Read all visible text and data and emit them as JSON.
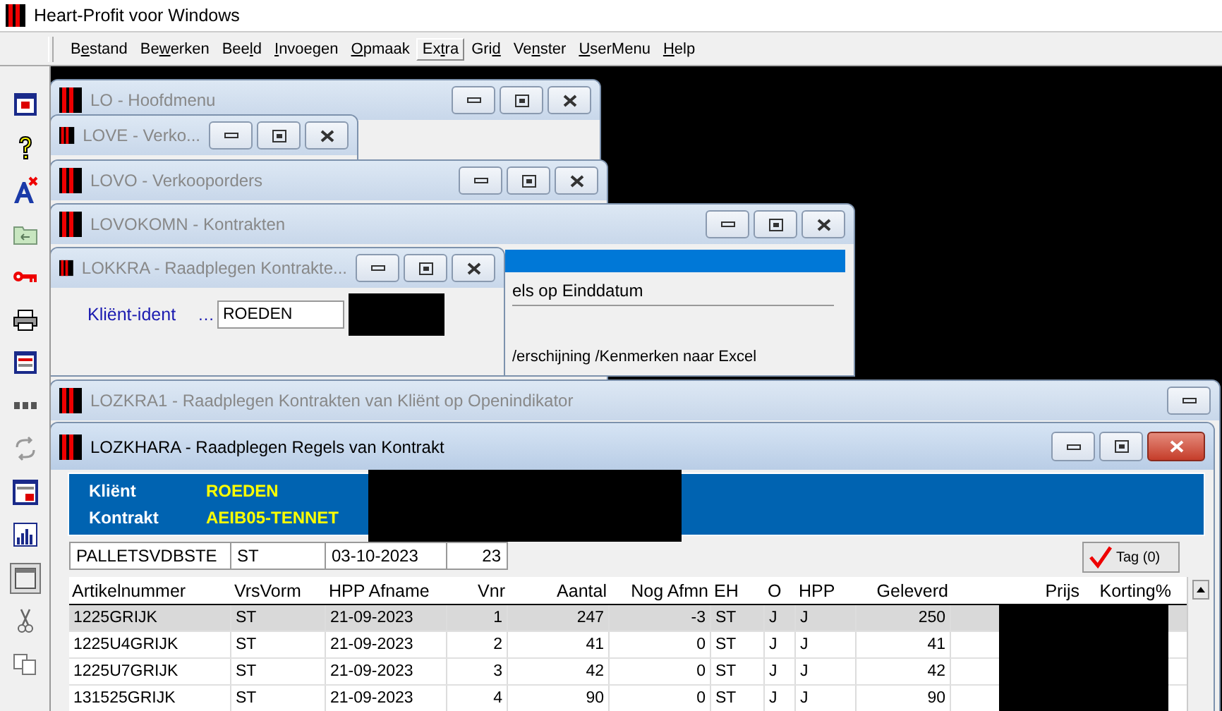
{
  "app": {
    "title": "Heart-Profit voor Windows"
  },
  "menu": [
    {
      "pre": "B",
      "key": "e",
      "post": "stand",
      "selected": false
    },
    {
      "pre": "Be",
      "key": "w",
      "post": "erken",
      "selected": false
    },
    {
      "pre": "Bee",
      "key": "l",
      "post": "d",
      "selected": false
    },
    {
      "key": "I",
      "post": "nvoegen",
      "selected": false
    },
    {
      "key": "O",
      "post": "pmaak",
      "selected": false
    },
    {
      "pre": "Ex",
      "key": "t",
      "post": "ra",
      "selected": true
    },
    {
      "pre": "Gri",
      "key": "d",
      "selected": false
    },
    {
      "pre": "Ve",
      "key": "n",
      "post": "ster",
      "selected": false
    },
    {
      "key": "U",
      "post": "serMenu",
      "selected": false
    },
    {
      "key": "H",
      "post": "elp",
      "selected": false
    }
  ],
  "windows": [
    {
      "kind": "menu",
      "title": "LO - Hoofdmenu",
      "active": false
    },
    {
      "kind": "sales",
      "title": "LOVE - Verko...",
      "active": false
    },
    {
      "kind": "orders",
      "title": "LOVO - Verkooporders",
      "active": false
    },
    {
      "kind": "contracts",
      "title": "LOVOKOMN - Kontrakten",
      "active": false,
      "lines": [
        "els op Einddatum",
        "/erschijning /Kenmerken naar Excel"
      ]
    },
    {
      "kind": "lookup",
      "title": "LOKKRA - Raadplegen Kontrakte...",
      "active": false,
      "label": "Kliënt-ident",
      "ellipsis": "…",
      "value": "ROEDEN"
    },
    {
      "kind": "list",
      "title": "LOZKRA1 - Raadplegen Kontrakten van Kliënt op Openindikator",
      "active": false
    },
    {
      "kind": "lines",
      "title": "LOZKHARA - Raadplegen Regels van Kontrakt",
      "active": true
    }
  ],
  "header_panel": [
    {
      "label": "Kliënt",
      "value": "ROEDEN"
    },
    {
      "label": "Kontrakt",
      "value": "AEIB05-TENNET"
    }
  ],
  "info_row": [
    "PALLETSVDBSTE",
    "ST",
    "03-10-2023",
    "23"
  ],
  "tag_button": {
    "label": "Tag (0)"
  },
  "grid": {
    "columns": [
      "Artikelnummer",
      "VrsVorm",
      "HPP Afname",
      "Vnr",
      "Aantal",
      "Nog Afmn",
      "EH",
      "O",
      "HPP",
      "Geleverd",
      "Prijs",
      "Korting%"
    ],
    "rows": [
      {
        "selected": true,
        "cells": [
          "1225GRIJK",
          "ST",
          "21-09-2023",
          "1",
          "247",
          "-3",
          "ST",
          "J",
          "J",
          "250"
        ]
      },
      {
        "selected": false,
        "cells": [
          "1225U4GRIJK",
          "ST",
          "21-09-2023",
          "2",
          "41",
          "0",
          "ST",
          "J",
          "J",
          "41"
        ]
      },
      {
        "selected": false,
        "cells": [
          "1225U7GRIJK",
          "ST",
          "21-09-2023",
          "3",
          "42",
          "0",
          "ST",
          "J",
          "J",
          "42"
        ]
      },
      {
        "selected": false,
        "cells": [
          "131525GRIJK",
          "ST",
          "21-09-2023",
          "4",
          "90",
          "0",
          "ST",
          "J",
          "J",
          "90"
        ]
      }
    ]
  }
}
